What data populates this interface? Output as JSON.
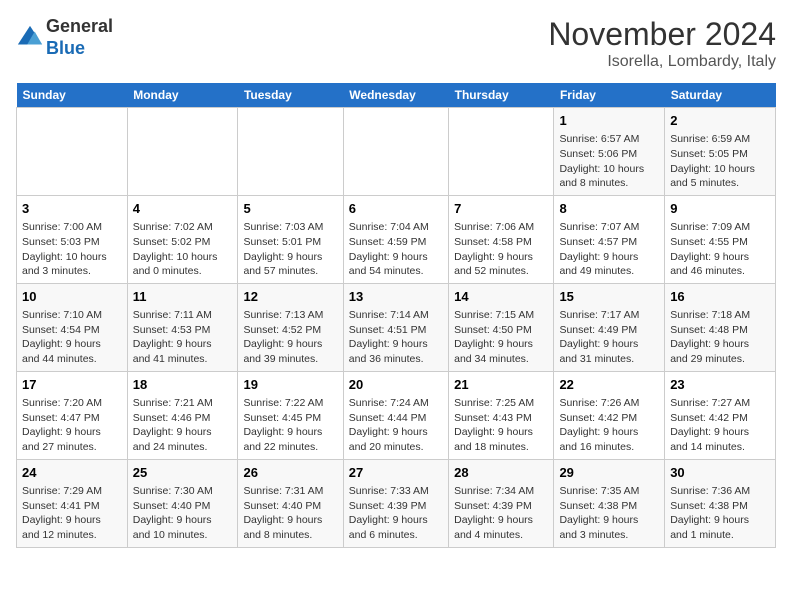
{
  "header": {
    "logo_line1": "General",
    "logo_line2": "Blue",
    "month_title": "November 2024",
    "location": "Isorella, Lombardy, Italy"
  },
  "weekdays": [
    "Sunday",
    "Monday",
    "Tuesday",
    "Wednesday",
    "Thursday",
    "Friday",
    "Saturday"
  ],
  "weeks": [
    [
      {
        "day": "",
        "detail": ""
      },
      {
        "day": "",
        "detail": ""
      },
      {
        "day": "",
        "detail": ""
      },
      {
        "day": "",
        "detail": ""
      },
      {
        "day": "",
        "detail": ""
      },
      {
        "day": "1",
        "detail": "Sunrise: 6:57 AM\nSunset: 5:06 PM\nDaylight: 10 hours\nand 8 minutes."
      },
      {
        "day": "2",
        "detail": "Sunrise: 6:59 AM\nSunset: 5:05 PM\nDaylight: 10 hours\nand 5 minutes."
      }
    ],
    [
      {
        "day": "3",
        "detail": "Sunrise: 7:00 AM\nSunset: 5:03 PM\nDaylight: 10 hours\nand 3 minutes."
      },
      {
        "day": "4",
        "detail": "Sunrise: 7:02 AM\nSunset: 5:02 PM\nDaylight: 10 hours\nand 0 minutes."
      },
      {
        "day": "5",
        "detail": "Sunrise: 7:03 AM\nSunset: 5:01 PM\nDaylight: 9 hours\nand 57 minutes."
      },
      {
        "day": "6",
        "detail": "Sunrise: 7:04 AM\nSunset: 4:59 PM\nDaylight: 9 hours\nand 54 minutes."
      },
      {
        "day": "7",
        "detail": "Sunrise: 7:06 AM\nSunset: 4:58 PM\nDaylight: 9 hours\nand 52 minutes."
      },
      {
        "day": "8",
        "detail": "Sunrise: 7:07 AM\nSunset: 4:57 PM\nDaylight: 9 hours\nand 49 minutes."
      },
      {
        "day": "9",
        "detail": "Sunrise: 7:09 AM\nSunset: 4:55 PM\nDaylight: 9 hours\nand 46 minutes."
      }
    ],
    [
      {
        "day": "10",
        "detail": "Sunrise: 7:10 AM\nSunset: 4:54 PM\nDaylight: 9 hours\nand 44 minutes."
      },
      {
        "day": "11",
        "detail": "Sunrise: 7:11 AM\nSunset: 4:53 PM\nDaylight: 9 hours\nand 41 minutes."
      },
      {
        "day": "12",
        "detail": "Sunrise: 7:13 AM\nSunset: 4:52 PM\nDaylight: 9 hours\nand 39 minutes."
      },
      {
        "day": "13",
        "detail": "Sunrise: 7:14 AM\nSunset: 4:51 PM\nDaylight: 9 hours\nand 36 minutes."
      },
      {
        "day": "14",
        "detail": "Sunrise: 7:15 AM\nSunset: 4:50 PM\nDaylight: 9 hours\nand 34 minutes."
      },
      {
        "day": "15",
        "detail": "Sunrise: 7:17 AM\nSunset: 4:49 PM\nDaylight: 9 hours\nand 31 minutes."
      },
      {
        "day": "16",
        "detail": "Sunrise: 7:18 AM\nSunset: 4:48 PM\nDaylight: 9 hours\nand 29 minutes."
      }
    ],
    [
      {
        "day": "17",
        "detail": "Sunrise: 7:20 AM\nSunset: 4:47 PM\nDaylight: 9 hours\nand 27 minutes."
      },
      {
        "day": "18",
        "detail": "Sunrise: 7:21 AM\nSunset: 4:46 PM\nDaylight: 9 hours\nand 24 minutes."
      },
      {
        "day": "19",
        "detail": "Sunrise: 7:22 AM\nSunset: 4:45 PM\nDaylight: 9 hours\nand 22 minutes."
      },
      {
        "day": "20",
        "detail": "Sunrise: 7:24 AM\nSunset: 4:44 PM\nDaylight: 9 hours\nand 20 minutes."
      },
      {
        "day": "21",
        "detail": "Sunrise: 7:25 AM\nSunset: 4:43 PM\nDaylight: 9 hours\nand 18 minutes."
      },
      {
        "day": "22",
        "detail": "Sunrise: 7:26 AM\nSunset: 4:42 PM\nDaylight: 9 hours\nand 16 minutes."
      },
      {
        "day": "23",
        "detail": "Sunrise: 7:27 AM\nSunset: 4:42 PM\nDaylight: 9 hours\nand 14 minutes."
      }
    ],
    [
      {
        "day": "24",
        "detail": "Sunrise: 7:29 AM\nSunset: 4:41 PM\nDaylight: 9 hours\nand 12 minutes."
      },
      {
        "day": "25",
        "detail": "Sunrise: 7:30 AM\nSunset: 4:40 PM\nDaylight: 9 hours\nand 10 minutes."
      },
      {
        "day": "26",
        "detail": "Sunrise: 7:31 AM\nSunset: 4:40 PM\nDaylight: 9 hours\nand 8 minutes."
      },
      {
        "day": "27",
        "detail": "Sunrise: 7:33 AM\nSunset: 4:39 PM\nDaylight: 9 hours\nand 6 minutes."
      },
      {
        "day": "28",
        "detail": "Sunrise: 7:34 AM\nSunset: 4:39 PM\nDaylight: 9 hours\nand 4 minutes."
      },
      {
        "day": "29",
        "detail": "Sunrise: 7:35 AM\nSunset: 4:38 PM\nDaylight: 9 hours\nand 3 minutes."
      },
      {
        "day": "30",
        "detail": "Sunrise: 7:36 AM\nSunset: 4:38 PM\nDaylight: 9 hours\nand 1 minute."
      }
    ]
  ]
}
